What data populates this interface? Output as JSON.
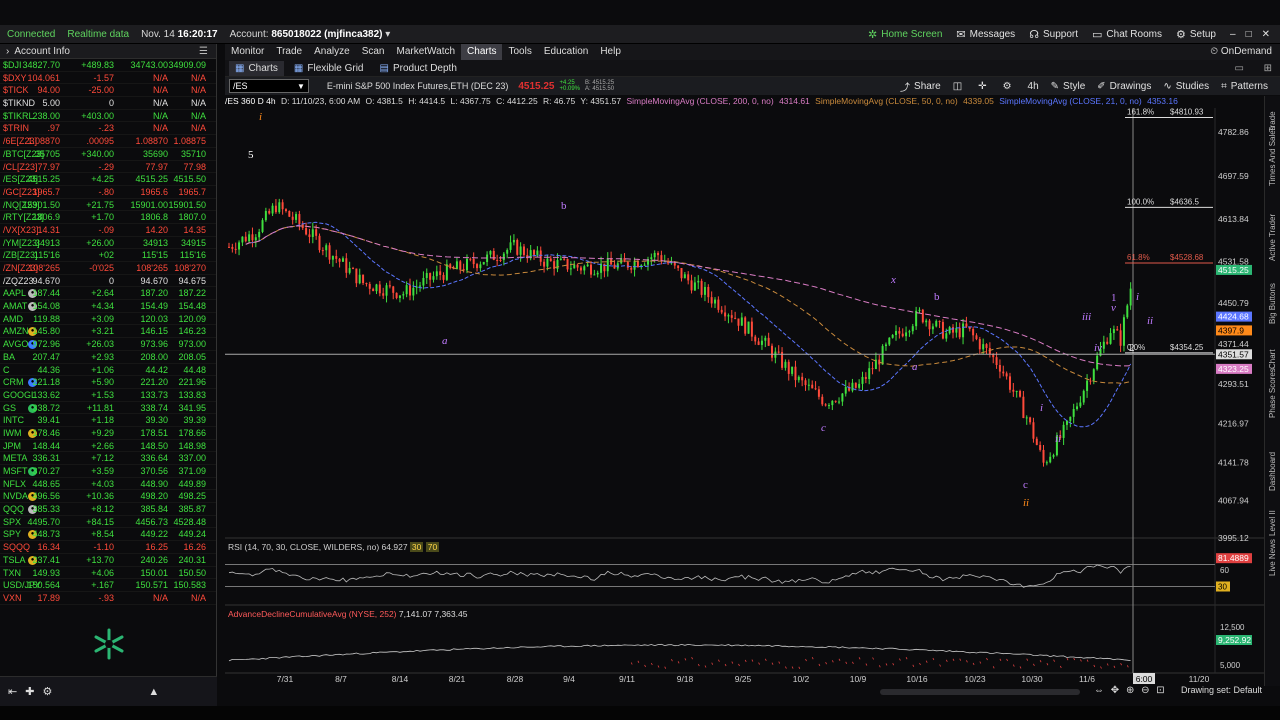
{
  "status": {
    "connected": "Connected",
    "realtime": "Realtime data",
    "date": "Nov. 14",
    "time": "16:20:17",
    "account_label": "Account:",
    "account": "865018022 (mjfinca382)"
  },
  "topnav": {
    "home": "Home Screen",
    "messages": "Messages",
    "support": "Support",
    "chatrooms": "Chat Rooms",
    "setup": "Setup"
  },
  "left": {
    "title": "Account Info",
    "rows": [
      {
        "sym": "$DJI",
        "last": "34827.70",
        "chg": "+489.83",
        "bid": "34743.00",
        "ask": "34909.09",
        "c": "g"
      },
      {
        "sym": "$DXY",
        "last": "104.061",
        "chg": "-1.57",
        "bid": "N/A",
        "ask": "N/A",
        "c": "r"
      },
      {
        "sym": "$TICK",
        "last": "94.00",
        "chg": "-25.00",
        "bid": "N/A",
        "ask": "N/A",
        "c": "r"
      },
      {
        "sym": "$TIKND",
        "last": "5.00",
        "chg": "0",
        "bid": "N/A",
        "ask": "N/A",
        "c": "w"
      },
      {
        "sym": "$TIKRL",
        "last": "238.00",
        "chg": "+403.00",
        "bid": "N/A",
        "ask": "N/A",
        "c": "g"
      },
      {
        "sym": "$TRIN",
        "last": ".97",
        "chg": "-.23",
        "bid": "N/A",
        "ask": "N/A",
        "c": "r"
      },
      {
        "sym": "/6E[Z23]",
        "last": "1.08870",
        "chg": ".00095",
        "bid": "1.08870",
        "ask": "1.08875",
        "c": "r"
      },
      {
        "sym": "/BTC[Z23]",
        "last": "35705",
        "chg": "+340.00",
        "bid": "35690",
        "ask": "35710",
        "c": "g"
      },
      {
        "sym": "/CL[Z23]",
        "last": "77.97",
        "chg": "-.29",
        "bid": "77.97",
        "ask": "77.98",
        "c": "r"
      },
      {
        "sym": "/ES[Z23]",
        "last": "4515.25",
        "chg": "+4.25",
        "bid": "4515.25",
        "ask": "4515.50",
        "c": "g"
      },
      {
        "sym": "/GC[Z23]",
        "last": "1965.7",
        "chg": "-.80",
        "bid": "1965.6",
        "ask": "1965.7",
        "c": "r"
      },
      {
        "sym": "/NQ[Z23]",
        "last": "15901.50",
        "chg": "+21.75",
        "bid": "15901.00",
        "ask": "15901.50",
        "c": "g"
      },
      {
        "sym": "/RTY[Z23]",
        "last": "1806.9",
        "chg": "+1.70",
        "bid": "1806.8",
        "ask": "1807.0",
        "c": "g"
      },
      {
        "sym": "/VX[X23]",
        "last": "14.31",
        "chg": "-.09",
        "bid": "14.20",
        "ask": "14.35",
        "c": "r"
      },
      {
        "sym": "/YM[Z23]",
        "last": "34913",
        "chg": "+26.00",
        "bid": "34913",
        "ask": "34915",
        "c": "g"
      },
      {
        "sym": "/ZB[Z23]",
        "last": "115'16",
        "chg": "+02",
        "bid": "115'15",
        "ask": "115'16",
        "c": "g"
      },
      {
        "sym": "/ZN[Z23]",
        "last": "108'265",
        "chg": "-0'025",
        "bid": "108'265",
        "ask": "108'270",
        "c": "r"
      },
      {
        "sym": "/ZQZ23",
        "last": "94.670",
        "chg": "0",
        "bid": "94.670",
        "ask": "94.675",
        "c": "w"
      },
      {
        "sym": "AAPL",
        "last": "187.44",
        "chg": "+2.64",
        "bid": "187.20",
        "ask": "187.22",
        "c": "g",
        "badge": "gray"
      },
      {
        "sym": "AMAT",
        "last": "154.08",
        "chg": "+4.34",
        "bid": "154.49",
        "ask": "154.48",
        "c": "g",
        "badge": "gray"
      },
      {
        "sym": "AMD",
        "last": "119.88",
        "chg": "+3.09",
        "bid": "120.03",
        "ask": "120.09",
        "c": "g"
      },
      {
        "sym": "AMZN",
        "last": "145.80",
        "chg": "+3.21",
        "bid": "146.15",
        "ask": "146.23",
        "c": "g",
        "badge": "yellow"
      },
      {
        "sym": "AVGO",
        "last": "972.96",
        "chg": "+26.03",
        "bid": "973.96",
        "ask": "973.00",
        "c": "g",
        "badge": "blue"
      },
      {
        "sym": "BA",
        "last": "207.47",
        "chg": "+2.93",
        "bid": "208.00",
        "ask": "208.05",
        "c": "g"
      },
      {
        "sym": "C",
        "last": "44.36",
        "chg": "+1.06",
        "bid": "44.42",
        "ask": "44.48",
        "c": "g"
      },
      {
        "sym": "CRM",
        "last": "221.18",
        "chg": "+5.90",
        "bid": "221.20",
        "ask": "221.96",
        "c": "g",
        "badge": "blue"
      },
      {
        "sym": "GOOGL",
        "last": "133.62",
        "chg": "+1.53",
        "bid": "133.73",
        "ask": "133.83",
        "c": "g"
      },
      {
        "sym": "GS",
        "last": "338.72",
        "chg": "+11.81",
        "bid": "338.74",
        "ask": "341.95",
        "c": "g",
        "badge": "green"
      },
      {
        "sym": "INTC",
        "last": "39.41",
        "chg": "+1.18",
        "bid": "39.30",
        "ask": "39.39",
        "c": "g"
      },
      {
        "sym": "IWM",
        "last": "178.46",
        "chg": "+9.29",
        "bid": "178.51",
        "ask": "178.66",
        "c": "g",
        "badge": "yellow"
      },
      {
        "sym": "JPM",
        "last": "148.44",
        "chg": "+2.66",
        "bid": "148.50",
        "ask": "148.98",
        "c": "g"
      },
      {
        "sym": "META",
        "last": "336.31",
        "chg": "+7.12",
        "bid": "336.64",
        "ask": "337.00",
        "c": "g"
      },
      {
        "sym": "MSFT",
        "last": "370.27",
        "chg": "+3.59",
        "bid": "370.56",
        "ask": "371.09",
        "c": "g",
        "badge": "green"
      },
      {
        "sym": "NFLX",
        "last": "448.65",
        "chg": "+4.03",
        "bid": "448.90",
        "ask": "449.89",
        "c": "g"
      },
      {
        "sym": "NVDA",
        "last": "496.56",
        "chg": "+10.36",
        "bid": "498.20",
        "ask": "498.25",
        "c": "g",
        "badge": "yellow"
      },
      {
        "sym": "QQQ",
        "last": "385.33",
        "chg": "+8.12",
        "bid": "385.84",
        "ask": "385.87",
        "c": "g",
        "badge": "gray"
      },
      {
        "sym": "SPX",
        "last": "4495.70",
        "chg": "+84.15",
        "bid": "4456.73",
        "ask": "4528.48",
        "c": "g"
      },
      {
        "sym": "SPY",
        "last": "448.73",
        "chg": "+8.54",
        "bid": "449.22",
        "ask": "449.24",
        "c": "g",
        "badge": "yellow"
      },
      {
        "sym": "SQQQ",
        "last": "16.34",
        "chg": "-1.10",
        "bid": "16.25",
        "ask": "16.26",
        "c": "r"
      },
      {
        "sym": "TSLA",
        "last": "237.41",
        "chg": "+13.70",
        "bid": "240.26",
        "ask": "240.31",
        "c": "g",
        "badge": "yellow"
      },
      {
        "sym": "TXN",
        "last": "149.93",
        "chg": "+4.06",
        "bid": "150.01",
        "ask": "150.50",
        "c": "g"
      },
      {
        "sym": "USD/JPY",
        "last": "150.564",
        "chg": "+.167",
        "bid": "150.571",
        "ask": "150.583",
        "c": "g"
      },
      {
        "sym": "VXN",
        "last": "17.89",
        "chg": "-.93",
        "bid": "N/A",
        "ask": "N/A",
        "c": "r"
      }
    ]
  },
  "menu": {
    "items": [
      "Monitor",
      "Trade",
      "Analyze",
      "Scan",
      "MarketWatch",
      "Charts",
      "Tools",
      "Education",
      "Help"
    ],
    "active": "Charts",
    "ondemand": "OnDemand"
  },
  "subtabs": {
    "charts": "Charts",
    "flexgrid": "Flexible Grid",
    "depth": "Product Depth"
  },
  "toolbar": {
    "symbol": "/ES",
    "description": "E-mini S&P 500 Index Futures,ETH (DEC 23)",
    "last": "4515.25",
    "change": "+4.25",
    "change_pct": "+0.09%",
    "bid": "B: 4515.25",
    "ask": "A: 4515.50",
    "share": "Share",
    "timeframe": "4h",
    "style": "Style",
    "drawings": "Drawings",
    "studies": "Studies",
    "patterns": "Patterns"
  },
  "studyline": {
    "symbol": "/ES 360 D 4h",
    "date": "D: 11/10/23, 6:00 AM",
    "open": "O: 4381.5",
    "high": "H: 4414.5",
    "low": "L: 4367.75",
    "close": "C: 4412.25",
    "range": "R: 46.75",
    "y": "Y: 4351.57",
    "sma200": "SimpleMovingAvg (CLOSE, 200, 0, no)",
    "sma200_val": "4314.61",
    "sma50": "SimpleMovingAvg (CLOSE, 50, 0, no)",
    "sma50_val": "4339.05",
    "sma21": "SimpleMovingAvg (CLOSE, 21, 0, no)",
    "sma21_val": "4353.16"
  },
  "colors": {
    "up": "#3fe03f",
    "down": "#ff4a3a",
    "purple": "#c07bff",
    "orange": "#ff8a1a",
    "sma200": "#d97cc4",
    "sma50": "#c98a3c",
    "sma21": "#5b76ff"
  },
  "price_axis": {
    "ticks": [
      "4782.86",
      "4697.59",
      "4613.84",
      "4531.58",
      "4450.79",
      "4371.44",
      "4293.51",
      "4216.97",
      "4141.78",
      "4067.94",
      "3995.12"
    ]
  },
  "fib": {
    "l1618": "161.8%",
    "l1618_val": "$4810.93",
    "l100": "100.0%",
    "l100_val": "$4636.5",
    "l618": "61.8%",
    "l618_val": "$4528.68",
    "l0": "0.0%",
    "l0_val": "$4354.25"
  },
  "price_badges": {
    "last": "4515.25",
    "b1": "4424.68",
    "b2": "4397.9",
    "cross": "4351.57",
    "b3": "4323.25"
  },
  "waves": {
    "i": "i",
    "five": "5",
    "a1": "a",
    "b1": "b",
    "c1": "c",
    "a2": "a",
    "b2": "b",
    "x": "x",
    "c2": "c",
    "ii_low": "ii",
    "w_i": "i",
    "w_ii": "ii",
    "w_iii": "iii",
    "w_iv": "iv",
    "w_v": "v",
    "one": "1",
    "two": "2",
    "w_i2": "i",
    "w_ii2": "ii"
  },
  "rsi": {
    "label": "RSI (14, 70, 30, CLOSE, WILDERS, no)",
    "value": "64.927",
    "ob": "30",
    "os": "70",
    "last": "81.4889",
    "t60": "60",
    "t30": "30"
  },
  "ad": {
    "label": "AdvanceDeclineCumulativeAvg (NYSE, 252)",
    "v1": "7,141.07",
    "v2": "7,363.45",
    "t12500": "12,500",
    "last": "9,252.92",
    "t5000": "5,000"
  },
  "dates": [
    "7/31",
    "8/7",
    "8/14",
    "8/21",
    "8/28",
    "9/4",
    "9/11",
    "9/18",
    "9/25",
    "10/2",
    "10/9",
    "10/16",
    "10/23",
    "10/30",
    "11/6",
    "11/13",
    "11/20"
  ],
  "crosshair_time": "6:00",
  "drawing_set": "Drawing set: Default",
  "sidetabs": [
    "Trade",
    "Times And Sales",
    "Active Trader",
    "Big Buttons",
    "Chart",
    "Phase Scores",
    "Dashboard",
    "Level II",
    "Live News"
  ]
}
